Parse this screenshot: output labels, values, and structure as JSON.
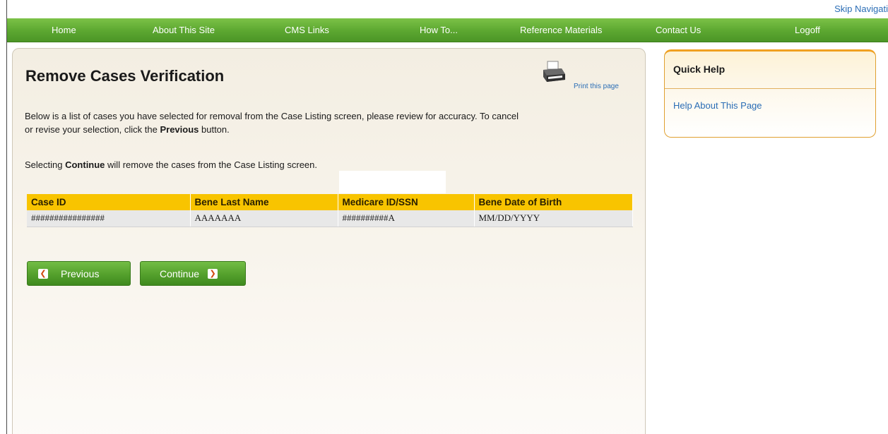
{
  "skip_navigation": "Skip Navigati",
  "nav": {
    "items": [
      "Home",
      "About This Site",
      "CMS Links",
      "How To...",
      "Reference Materials",
      "Contact Us",
      "Logoff"
    ]
  },
  "main": {
    "title": "Remove Cases Verification",
    "print_link": "Print this page",
    "para1_a": "Below is a list of cases you have selected for removal from the Case Listing screen, please review for accuracy. To cancel",
    "para1_b": "or revise your selection, click the ",
    "para1_bold": "Previous",
    "para1_c": " button.",
    "para2_a": "Selecting ",
    "para2_bold": "Continue",
    "para2_c": " will remove the cases from the Case Listing screen.",
    "table": {
      "headers": [
        "Case ID",
        "Bene Last Name",
        "Medicare ID/SSN",
        "Bene Date of Birth"
      ],
      "rows": [
        [
          "################",
          "AAAAAAA",
          "##########A",
          "MM/DD/YYYY"
        ]
      ]
    },
    "previous_label": "Previous",
    "continue_label": "Continue"
  },
  "quick_help": {
    "title": "Quick Help",
    "link": "Help About This Page"
  },
  "colors": {
    "nav_green": "#5ea932",
    "table_header_yellow": "#f8c400",
    "link_blue": "#2a6db5",
    "quick_help_border": "#f0a020"
  }
}
